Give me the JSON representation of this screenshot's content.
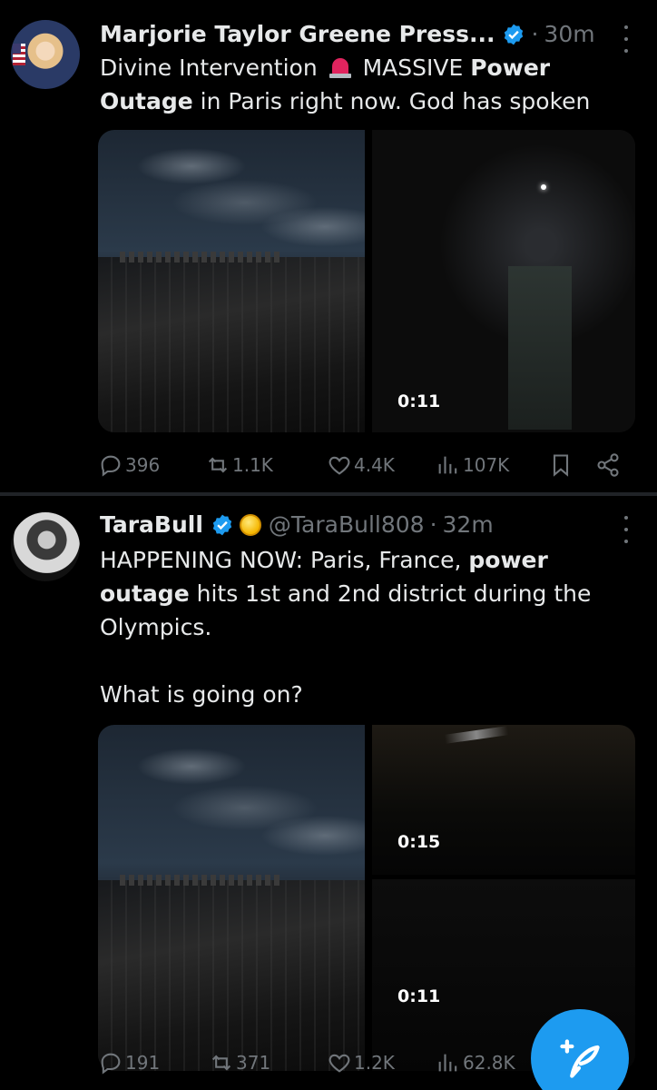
{
  "tweets": [
    {
      "name": "Marjorie Taylor Greene Press...",
      "handle": "",
      "time": "30m",
      "text": {
        "p1": "Divine Intervention ",
        "p2": " MASSIVE ",
        "bold1": "Power Outage",
        "p3": " in Paris right now. God has spoken"
      },
      "media": {
        "video_duration": "0:11"
      },
      "stats": {
        "replies": "396",
        "reposts": "1.1K",
        "likes": "4.4K",
        "views": "107K"
      }
    },
    {
      "name": "TaraBull",
      "handle": "@TaraBull808",
      "time": "32m",
      "text": {
        "p1": "HAPPENING NOW: Paris, France, ",
        "bold1": "power outage",
        "p2": " hits 1st and 2nd district during the Olympics.",
        "p3": "What is going on?"
      },
      "media": {
        "video_duration_1": "0:15",
        "video_duration_2": "0:11"
      },
      "stats": {
        "replies": "191",
        "reposts": "371",
        "likes": "1.2K",
        "views": "62.8K"
      }
    }
  ],
  "separator": "·",
  "colors": {
    "background": "#000000",
    "text": "#e7e9ea",
    "muted": "#71767b",
    "accent": "#1d9bf0",
    "divider": "#202327"
  },
  "icons": {
    "reply": "reply-icon",
    "repost": "repost-icon",
    "like": "heart-icon",
    "views": "views-icon",
    "bookmark": "bookmark-icon",
    "share": "share-icon",
    "more": "more-icon",
    "verified": "verified-badge-icon",
    "compose": "compose-icon",
    "siren": "siren-emoji-icon",
    "gold_badge": "gold-badge-icon"
  }
}
